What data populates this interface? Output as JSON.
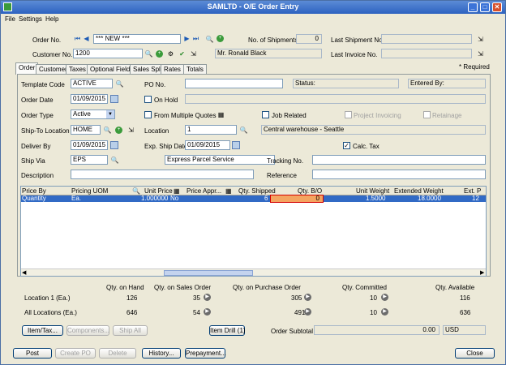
{
  "window": {
    "title": "SAMLTD - O/E Order Entry"
  },
  "menu": {
    "file": "File",
    "settings": "Settings",
    "help": "Help"
  },
  "header": {
    "order_no_label": "Order No.",
    "order_no_value": "*** NEW ***",
    "customer_no_label": "Customer No. *",
    "customer_no_value": "1200",
    "customer_name": "Mr. Ronald Black",
    "shipments_label": "No. of Shipments",
    "shipments_value": "0",
    "last_shipment_label": "Last Shipment No.",
    "last_invoice_label": "Last Invoice No.",
    "required_label": "Required"
  },
  "tabs": [
    "Order",
    "Customer",
    "Taxes",
    "Optional Fields",
    "Sales Split",
    "Rates",
    "Totals"
  ],
  "form": {
    "template_code_label": "Template Code",
    "template_code_value": "ACTIVE",
    "po_no_label": "PO No.",
    "status_label": "Status:",
    "entered_by_label": "Entered By:",
    "order_date_label": "Order Date",
    "order_date_value": "01/09/2015",
    "on_hold_label": "On Hold",
    "order_type_label": "Order Type",
    "order_type_value": "Active",
    "from_multiple_quotes_label": "From Multiple Quotes",
    "job_related_label": "Job Related",
    "project_invoicing_label": "Project Invoicing",
    "retainage_label": "Retainage",
    "ship_to_label": "Ship-To Location",
    "ship_to_value": "HOME",
    "location_label": "Location",
    "location_value": "1",
    "location_desc": "Central warehouse - Seattle",
    "deliver_by_label": "Deliver By",
    "deliver_by_value": "01/09/2015",
    "exp_ship_label": "Exp. Ship Date",
    "exp_ship_value": "01/09/2015",
    "calc_tax_label": "Calc. Tax",
    "ship_via_label": "Ship Via",
    "ship_via_value": "EPS",
    "ship_via_desc": "Express Parcel Service",
    "tracking_label": "Tracking No.",
    "description_label": "Description",
    "reference_label": "Reference"
  },
  "grid": {
    "headers": [
      "Price By",
      "Pricing UOM",
      "Unit Price",
      "Price Appr...",
      "Qty. Shipped",
      "Qty. B/O",
      "Unit Weight",
      "Extended Weight",
      "Ext. P"
    ],
    "row": [
      "Quantity",
      "Ea.",
      "1.000000",
      "No",
      "6",
      "0",
      "1.5000",
      "18.0000",
      "12"
    ]
  },
  "qty": {
    "on_hand_label": "Qty. on Hand",
    "on_sales_label": "Qty. on Sales Order",
    "on_po_label": "Qty. on Purchase Order",
    "committed_label": "Qty. Committed",
    "available_label": "Qty. Available",
    "loc_label": "Location  1 (Ea.)",
    "loc_on_hand": "126",
    "loc_on_sales": "35",
    "loc_on_po": "305",
    "loc_committed": "10",
    "loc_available": "116",
    "all_label": "All Locations (Ea.)",
    "all_on_hand": "646",
    "all_on_sales": "54",
    "all_on_po": "491",
    "all_committed": "10",
    "all_available": "636"
  },
  "buttons": {
    "item_tax": "Item/Tax...",
    "components": "Components...",
    "ship_all": "Ship All",
    "item_drill": "Item Drill (1)",
    "order_subtotal_label": "Order Subtotal",
    "order_subtotal_value": "0.00",
    "currency": "USD",
    "post": "Post",
    "create_po": "Create PO",
    "delete": "Delete",
    "history": "History...",
    "prepayment": "Prepayment...",
    "close": "Close"
  },
  "colors": {
    "title_bar": "#2d62c0",
    "selection": "#316ac5",
    "highlight_border": "#d40000",
    "highlight_fill": "#f4a460"
  }
}
